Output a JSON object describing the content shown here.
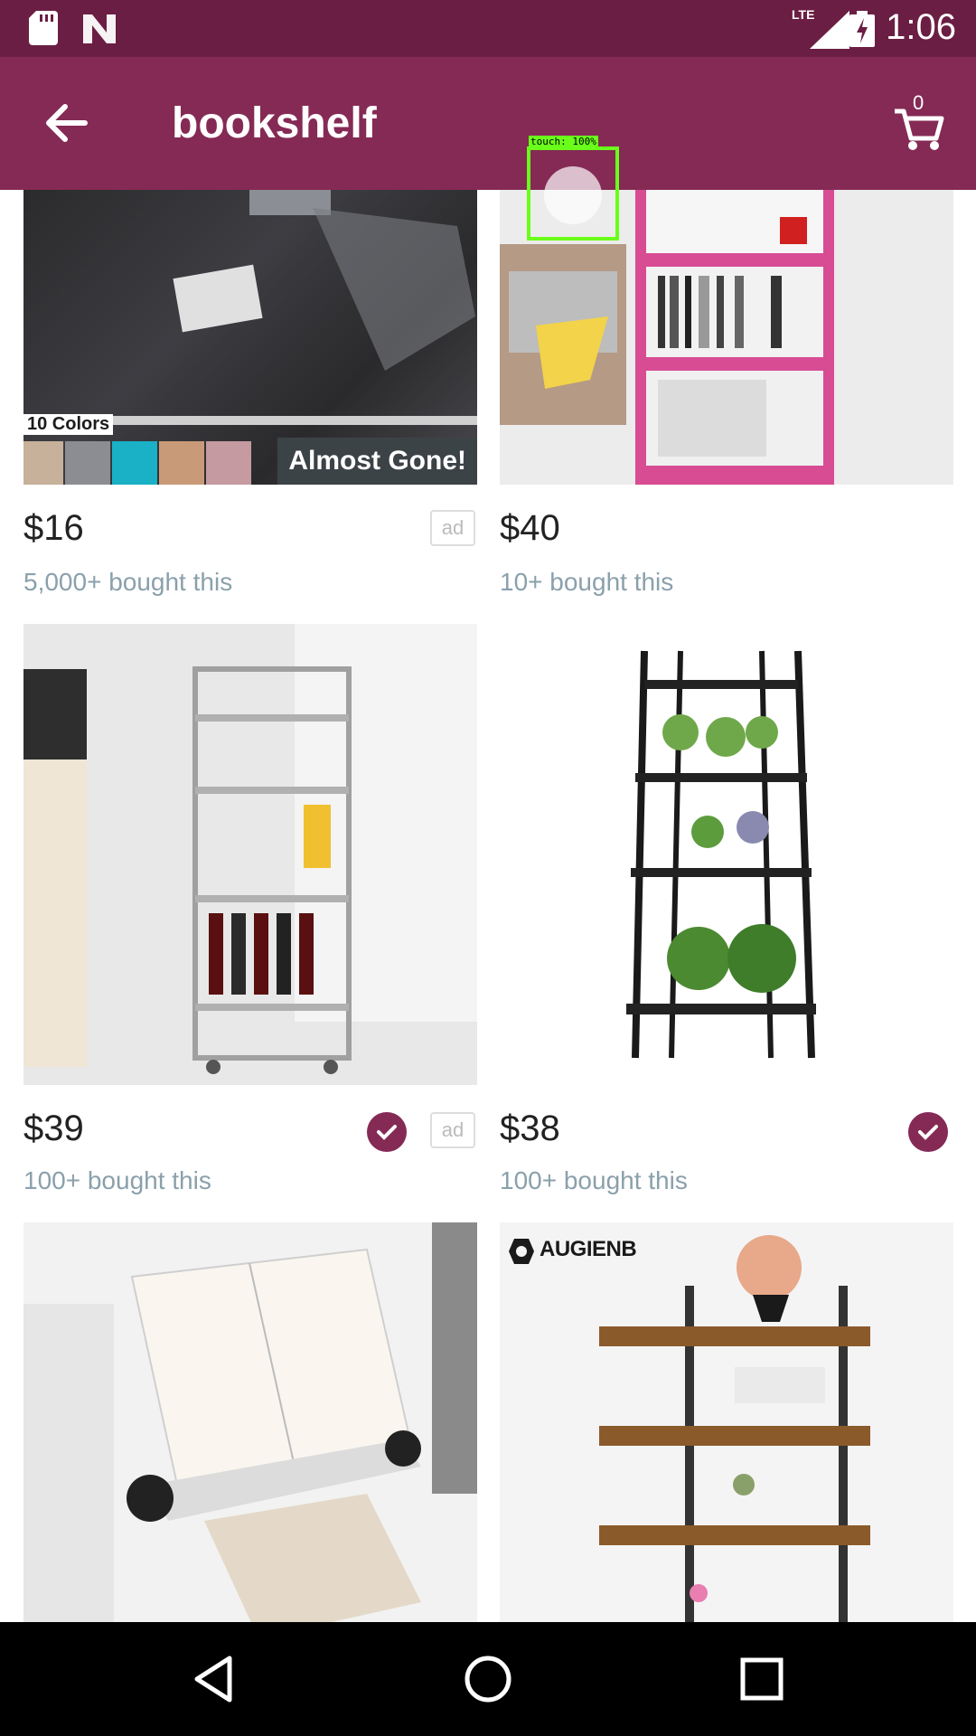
{
  "status_bar": {
    "network": "LTE",
    "time": "1:06",
    "icons": [
      "sd-card-icon",
      "n-logo-icon",
      "signal-icon",
      "battery-charging-icon"
    ]
  },
  "app_bar": {
    "title": "bookshelf",
    "cart_count": "0",
    "icons": [
      "back-arrow-icon",
      "cart-icon"
    ]
  },
  "touch_overlay": {
    "label": "touch: 100%"
  },
  "products": [
    {
      "price": "$16",
      "bought": "5,000+ bought this",
      "ad": "ad",
      "image_text": "10 Colors",
      "badge": "Almost Gone!",
      "verified": false
    },
    {
      "price": "$40",
      "bought": "10+ bought this",
      "verified": false
    },
    {
      "price": "$39",
      "bought": "100+ bought this",
      "ad": "ad",
      "verified": true
    },
    {
      "price": "$38",
      "bought": "100+ bought this",
      "verified": true
    },
    {
      "price": "",
      "bought": ""
    },
    {
      "price": "",
      "bought": "",
      "brand": "AUGIENB"
    }
  ],
  "nav_bar": {
    "icons": [
      "back-triangle-icon",
      "home-circle-icon",
      "recents-square-icon"
    ]
  },
  "colors": {
    "status_bar": "#6b1e43",
    "app_bar": "#852a55",
    "accent": "#852a55",
    "muted_text": "#8aa0ab",
    "touch_highlight": "#6aff1a"
  }
}
